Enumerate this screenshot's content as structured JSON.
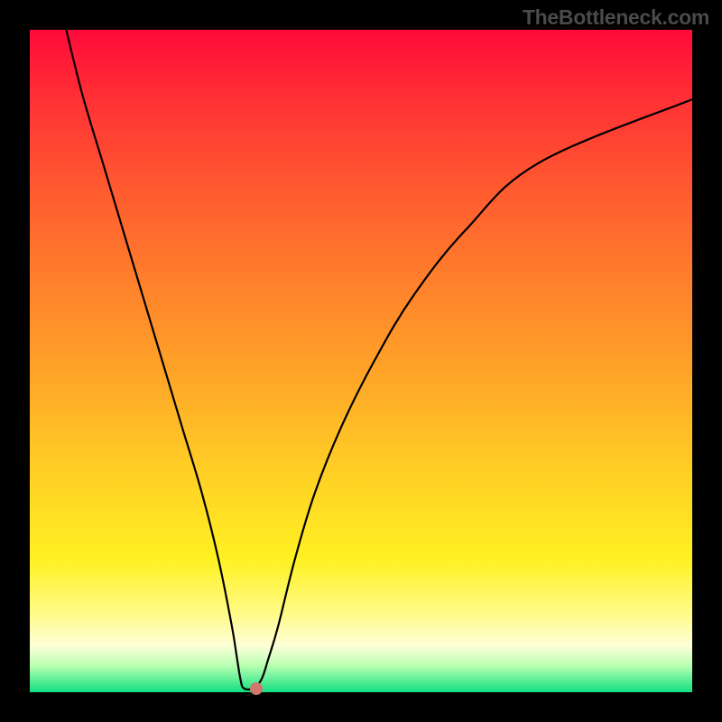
{
  "watermark": "TheBottleneck.com",
  "chart_data": {
    "type": "line",
    "title": "",
    "xlabel": "",
    "ylabel": "",
    "xlim": [
      0,
      100
    ],
    "ylim": [
      0,
      100
    ],
    "background_gradient": {
      "top": "#ff0a3a",
      "upper_mid": "#ff7d2c",
      "lower_mid": "#fff122",
      "bottom": "#10e082"
    },
    "curve_points": [
      {
        "x": 5.5,
        "y": 100
      },
      {
        "x": 8,
        "y": 90
      },
      {
        "x": 11,
        "y": 80
      },
      {
        "x": 14,
        "y": 70
      },
      {
        "x": 17,
        "y": 60
      },
      {
        "x": 20,
        "y": 50
      },
      {
        "x": 23,
        "y": 40
      },
      {
        "x": 26,
        "y": 30
      },
      {
        "x": 28.5,
        "y": 20
      },
      {
        "x": 30.5,
        "y": 10
      },
      {
        "x": 31.3,
        "y": 5
      },
      {
        "x": 31.8,
        "y": 2
      },
      {
        "x": 32.3,
        "y": 0.6
      },
      {
        "x": 33.8,
        "y": 0.6
      },
      {
        "x": 35,
        "y": 2
      },
      {
        "x": 36,
        "y": 5
      },
      {
        "x": 37.5,
        "y": 10
      },
      {
        "x": 40,
        "y": 20
      },
      {
        "x": 43,
        "y": 30
      },
      {
        "x": 47,
        "y": 40
      },
      {
        "x": 52,
        "y": 50
      },
      {
        "x": 58,
        "y": 60
      },
      {
        "x": 66,
        "y": 70
      },
      {
        "x": 77,
        "y": 80
      },
      {
        "x": 100,
        "y": 89.5
      }
    ],
    "marker": {
      "x": 34.2,
      "y": 0.6,
      "color": "#cf776c"
    }
  }
}
